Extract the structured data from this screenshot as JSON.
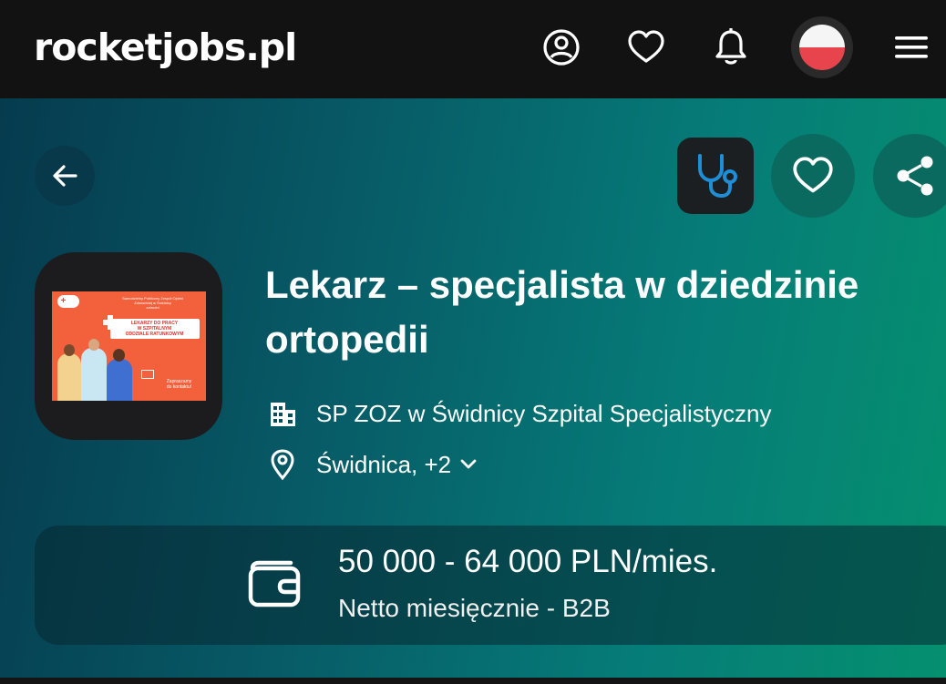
{
  "header": {
    "logo_text": "rocketjobs.pl",
    "icons": [
      "user-circle-icon",
      "heart-icon",
      "bell-icon",
      "poland-flag-icon",
      "hamburger-menu-icon"
    ]
  },
  "job": {
    "category_icon": "stethoscope-icon",
    "title": "Lekarz – specjalista w dziedzinie ortopedii",
    "company": "SP ZOZ w Świdnicy Szpital Specjalistyczny",
    "location": "Świdnica, +2",
    "logo_banner": {
      "line1": "Samodzielny Publiczny Zespół Opieki",
      "line2": "Zdrowotnej w Świdnicy",
      "line3": "zatrudni",
      "headline1": "LEKARZY DO PRACY",
      "headline2": "W SZPITALNYM",
      "headline3": "ODDZIALE RATUNKOWYM",
      "cta1": "Zapraszamy",
      "cta2": "do kontaktu!"
    }
  },
  "salary": {
    "amount": "50 000 - 64 000 PLN/mies.",
    "type": "Netto miesięcznie - B2B"
  },
  "colors": {
    "accent_dark": "#121212",
    "gradient_start": "#063b4e",
    "gradient_end": "#05906f",
    "flag_red": "#e8444d"
  }
}
